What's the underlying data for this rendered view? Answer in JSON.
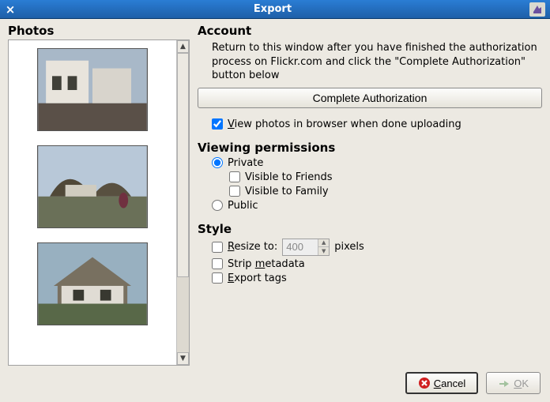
{
  "window": {
    "title": "Export"
  },
  "photos": {
    "heading": "Photos"
  },
  "account": {
    "heading": "Account",
    "instruction": "Return to this window after you have finished the authorization process on Flickr.com and click the \"Complete Authorization\" button below",
    "button": "Complete Authorization",
    "view_browser_pre": "V",
    "view_browser_post": "iew photos in browser when done uploading",
    "view_browser_checked": true
  },
  "permissions": {
    "heading": "Viewing permissions",
    "private": "Private",
    "visible_friends": "Visible to Friends",
    "visible_family": "Visible to Family",
    "public": "Public",
    "selected": "private"
  },
  "style": {
    "heading": "Style",
    "resize_pre": "R",
    "resize_mid": "esize to:",
    "resize_value": "400",
    "resize_suffix": "pixels",
    "strip_pre": "Strip ",
    "strip_ul": "m",
    "strip_post": "etadata",
    "export_ul": "E",
    "export_post": "xport tags"
  },
  "buttons": {
    "cancel_ul": "C",
    "cancel_post": "ancel",
    "ok_ul": "O",
    "ok_post": "K"
  }
}
